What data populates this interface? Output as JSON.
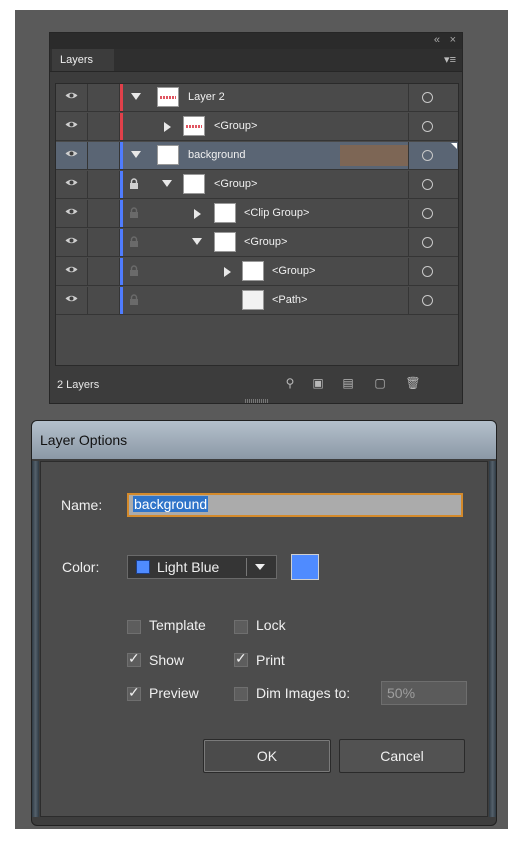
{
  "panel": {
    "tab_label": "Layers",
    "collapse_icon": "double-chevron-icon",
    "close_icon": "close-icon",
    "menu_icon": "panel-menu-icon",
    "layers_count": "2 Layers",
    "rows": [
      {
        "name": "Layer 2",
        "color": "#e0404a"
      },
      {
        "name": "<Group>",
        "color": "#e0404a"
      },
      {
        "name": "background",
        "color": "#4f7cff",
        "selected": true,
        "selection_swatch": "#7d6655"
      },
      {
        "name": "<Group>",
        "color": "#4f7cff"
      },
      {
        "name": "<Clip Group>",
        "color": "#4f7cff"
      },
      {
        "name": "<Group>",
        "color": "#4f7cff"
      },
      {
        "name": "<Group>",
        "color": "#4f7cff"
      },
      {
        "name": "<Path>",
        "color": "#4f7cff"
      }
    ],
    "footer_icons": [
      "search-icon",
      "collect-icon",
      "make-clipping-mask-icon",
      "new-layer-icon",
      "delete-icon"
    ]
  },
  "dialog": {
    "title": "Layer Options",
    "name_label": "Name:",
    "name_value": "background",
    "color_label": "Color:",
    "color_value": "Light Blue",
    "color_hex": "#4f8bff",
    "template_label": "Template",
    "template_checked": false,
    "lock_label": "Lock",
    "lock_checked": false,
    "show_label": "Show",
    "show_checked": true,
    "print_label": "Print",
    "print_checked": true,
    "preview_label": "Preview",
    "preview_checked": true,
    "dim_label": "Dim Images to:",
    "dim_checked": false,
    "dim_value": "50%",
    "ok_label": "OK",
    "cancel_label": "Cancel"
  }
}
